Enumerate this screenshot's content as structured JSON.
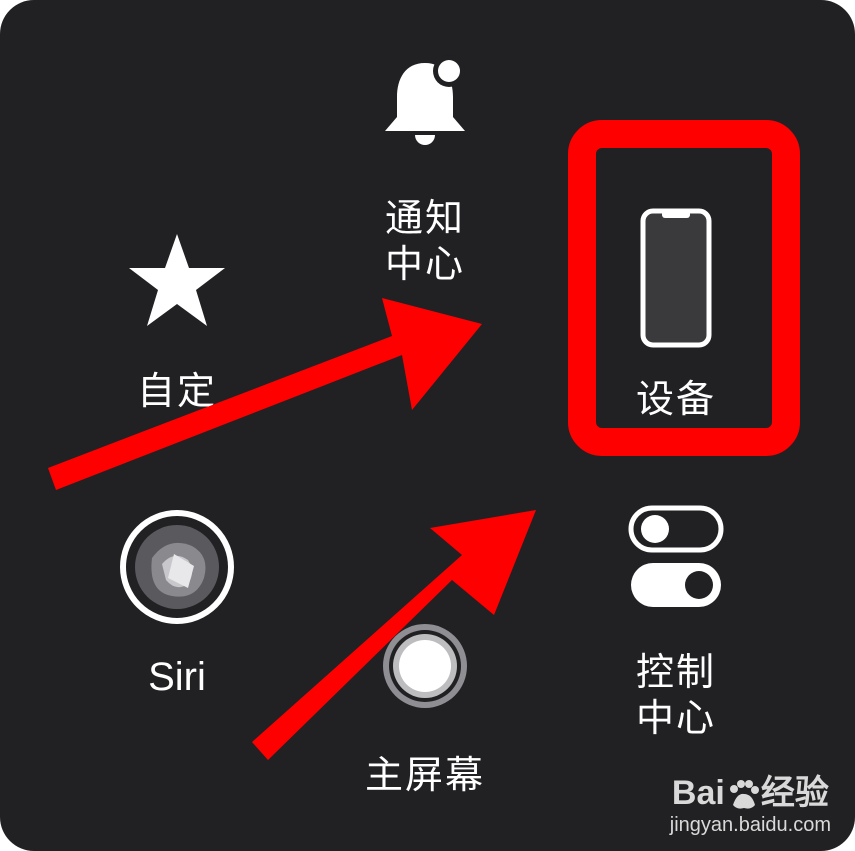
{
  "menu": {
    "notification_center": {
      "label_line1": "通知",
      "label_line2": "中心"
    },
    "custom": {
      "label": "自定"
    },
    "device": {
      "label": "设备"
    },
    "siri": {
      "label": "Siri"
    },
    "control_center": {
      "label_line1": "控制",
      "label_line2": "中心"
    },
    "home": {
      "label": "主屏幕"
    }
  },
  "annotations": {
    "highlight_color": "#ff0000",
    "arrow_color": "#ff0000"
  },
  "watermark": {
    "brand": "Bai",
    "brand_suffix": "经验",
    "url": "jingyan.baidu.com"
  },
  "colors": {
    "panel": "#212124",
    "icon": "#ffffff"
  },
  "icons": [
    "bell-icon",
    "star-icon",
    "phone-icon",
    "siri-icon",
    "toggle-icon",
    "home-button-icon"
  ]
}
